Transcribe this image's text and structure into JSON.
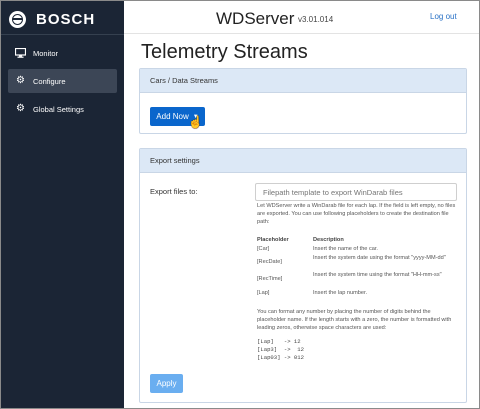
{
  "sidebar": {
    "brand": "BOSCH",
    "items": [
      {
        "label": "Monitor",
        "icon": "monitor-icon"
      },
      {
        "label": "Configure",
        "icon": "gear-icon",
        "active": true
      },
      {
        "label": "Global Settings",
        "icon": "gear-icon"
      }
    ]
  },
  "header": {
    "app_name": "WDServer",
    "version": "v3.01.014",
    "logout": "Log out"
  },
  "page_title": "Telemetry Streams",
  "cars_panel": {
    "title": "Cars / Data Streams",
    "add_button": "Add Now"
  },
  "export_panel": {
    "title": "Export settings",
    "label": "Export files to:",
    "input_value": "",
    "input_placeholder": "Filepath template to export WinDarab files",
    "help_text": "Let WDServer write a WinDarab file for each lap. If the field is left empty, no files are exported. You can use following placeholders to create the destination file path:",
    "table_headers": [
      "Placeholder",
      "Description"
    ],
    "placeholders": [
      {
        "name": "[Car]",
        "desc": "Insert the name of the car."
      },
      {
        "name": "[RecDate]",
        "desc": "Insert the system date using the format \"yyyy-MM-dd\""
      },
      {
        "name": "[RecTime]",
        "desc": "Insert the system time using the format \"HH-mm-ss\""
      },
      {
        "name": "[Lap]",
        "desc": "Insert the lap number."
      }
    ],
    "help_text2": "You can format any number by placing the number of digits behind the placeholder name. If the length starts with a zero, the number is formatted with leading zeros, otherwise space characters are used:",
    "examples": [
      "[Lap]   -> 12",
      "[Lap3]  ->  12",
      "[Lap03] -> 012"
    ],
    "apply_button": "Apply"
  },
  "colors": {
    "sidebar_bg": "#1b2535",
    "primary": "#0a66cc",
    "panel_header": "#dce8f6",
    "link": "#2a72c6"
  }
}
